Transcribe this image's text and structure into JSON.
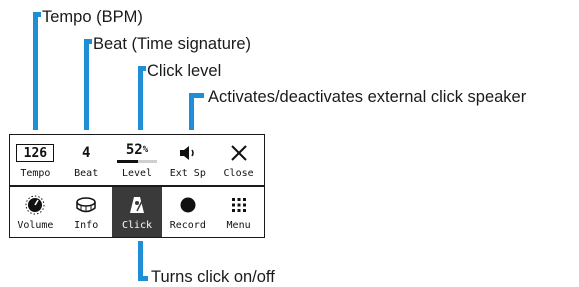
{
  "annotations": {
    "tempo": "Tempo (BPM)",
    "beat": "Beat (Time signature)",
    "level": "Click level",
    "ext": "Activates/deactivates external click speaker",
    "click": "Turns click on/off"
  },
  "panel": {
    "top_row": {
      "tempo": {
        "value": "126",
        "label": "Tempo"
      },
      "beat": {
        "value": "4",
        "label": "Beat"
      },
      "level": {
        "value": "52",
        "unit": "%",
        "label": "Level",
        "fill_fraction": 0.52
      },
      "ext": {
        "label": "Ext Sp",
        "icon": "speaker-icon"
      },
      "close": {
        "label": "Close",
        "icon": "close-icon"
      }
    },
    "bottom_row": {
      "volume": {
        "label": "Volume",
        "icon": "volume-knob-icon"
      },
      "info": {
        "label": "Info",
        "icon": "drum-icon"
      },
      "click": {
        "label": "Click",
        "icon": "metronome-icon",
        "active": true
      },
      "record": {
        "label": "Record",
        "icon": "record-icon"
      },
      "menu": {
        "label": "Menu",
        "icon": "grid-menu-icon"
      }
    }
  },
  "colors": {
    "accent": "#1e8fd6",
    "active_bg": "#3a3a3a"
  }
}
